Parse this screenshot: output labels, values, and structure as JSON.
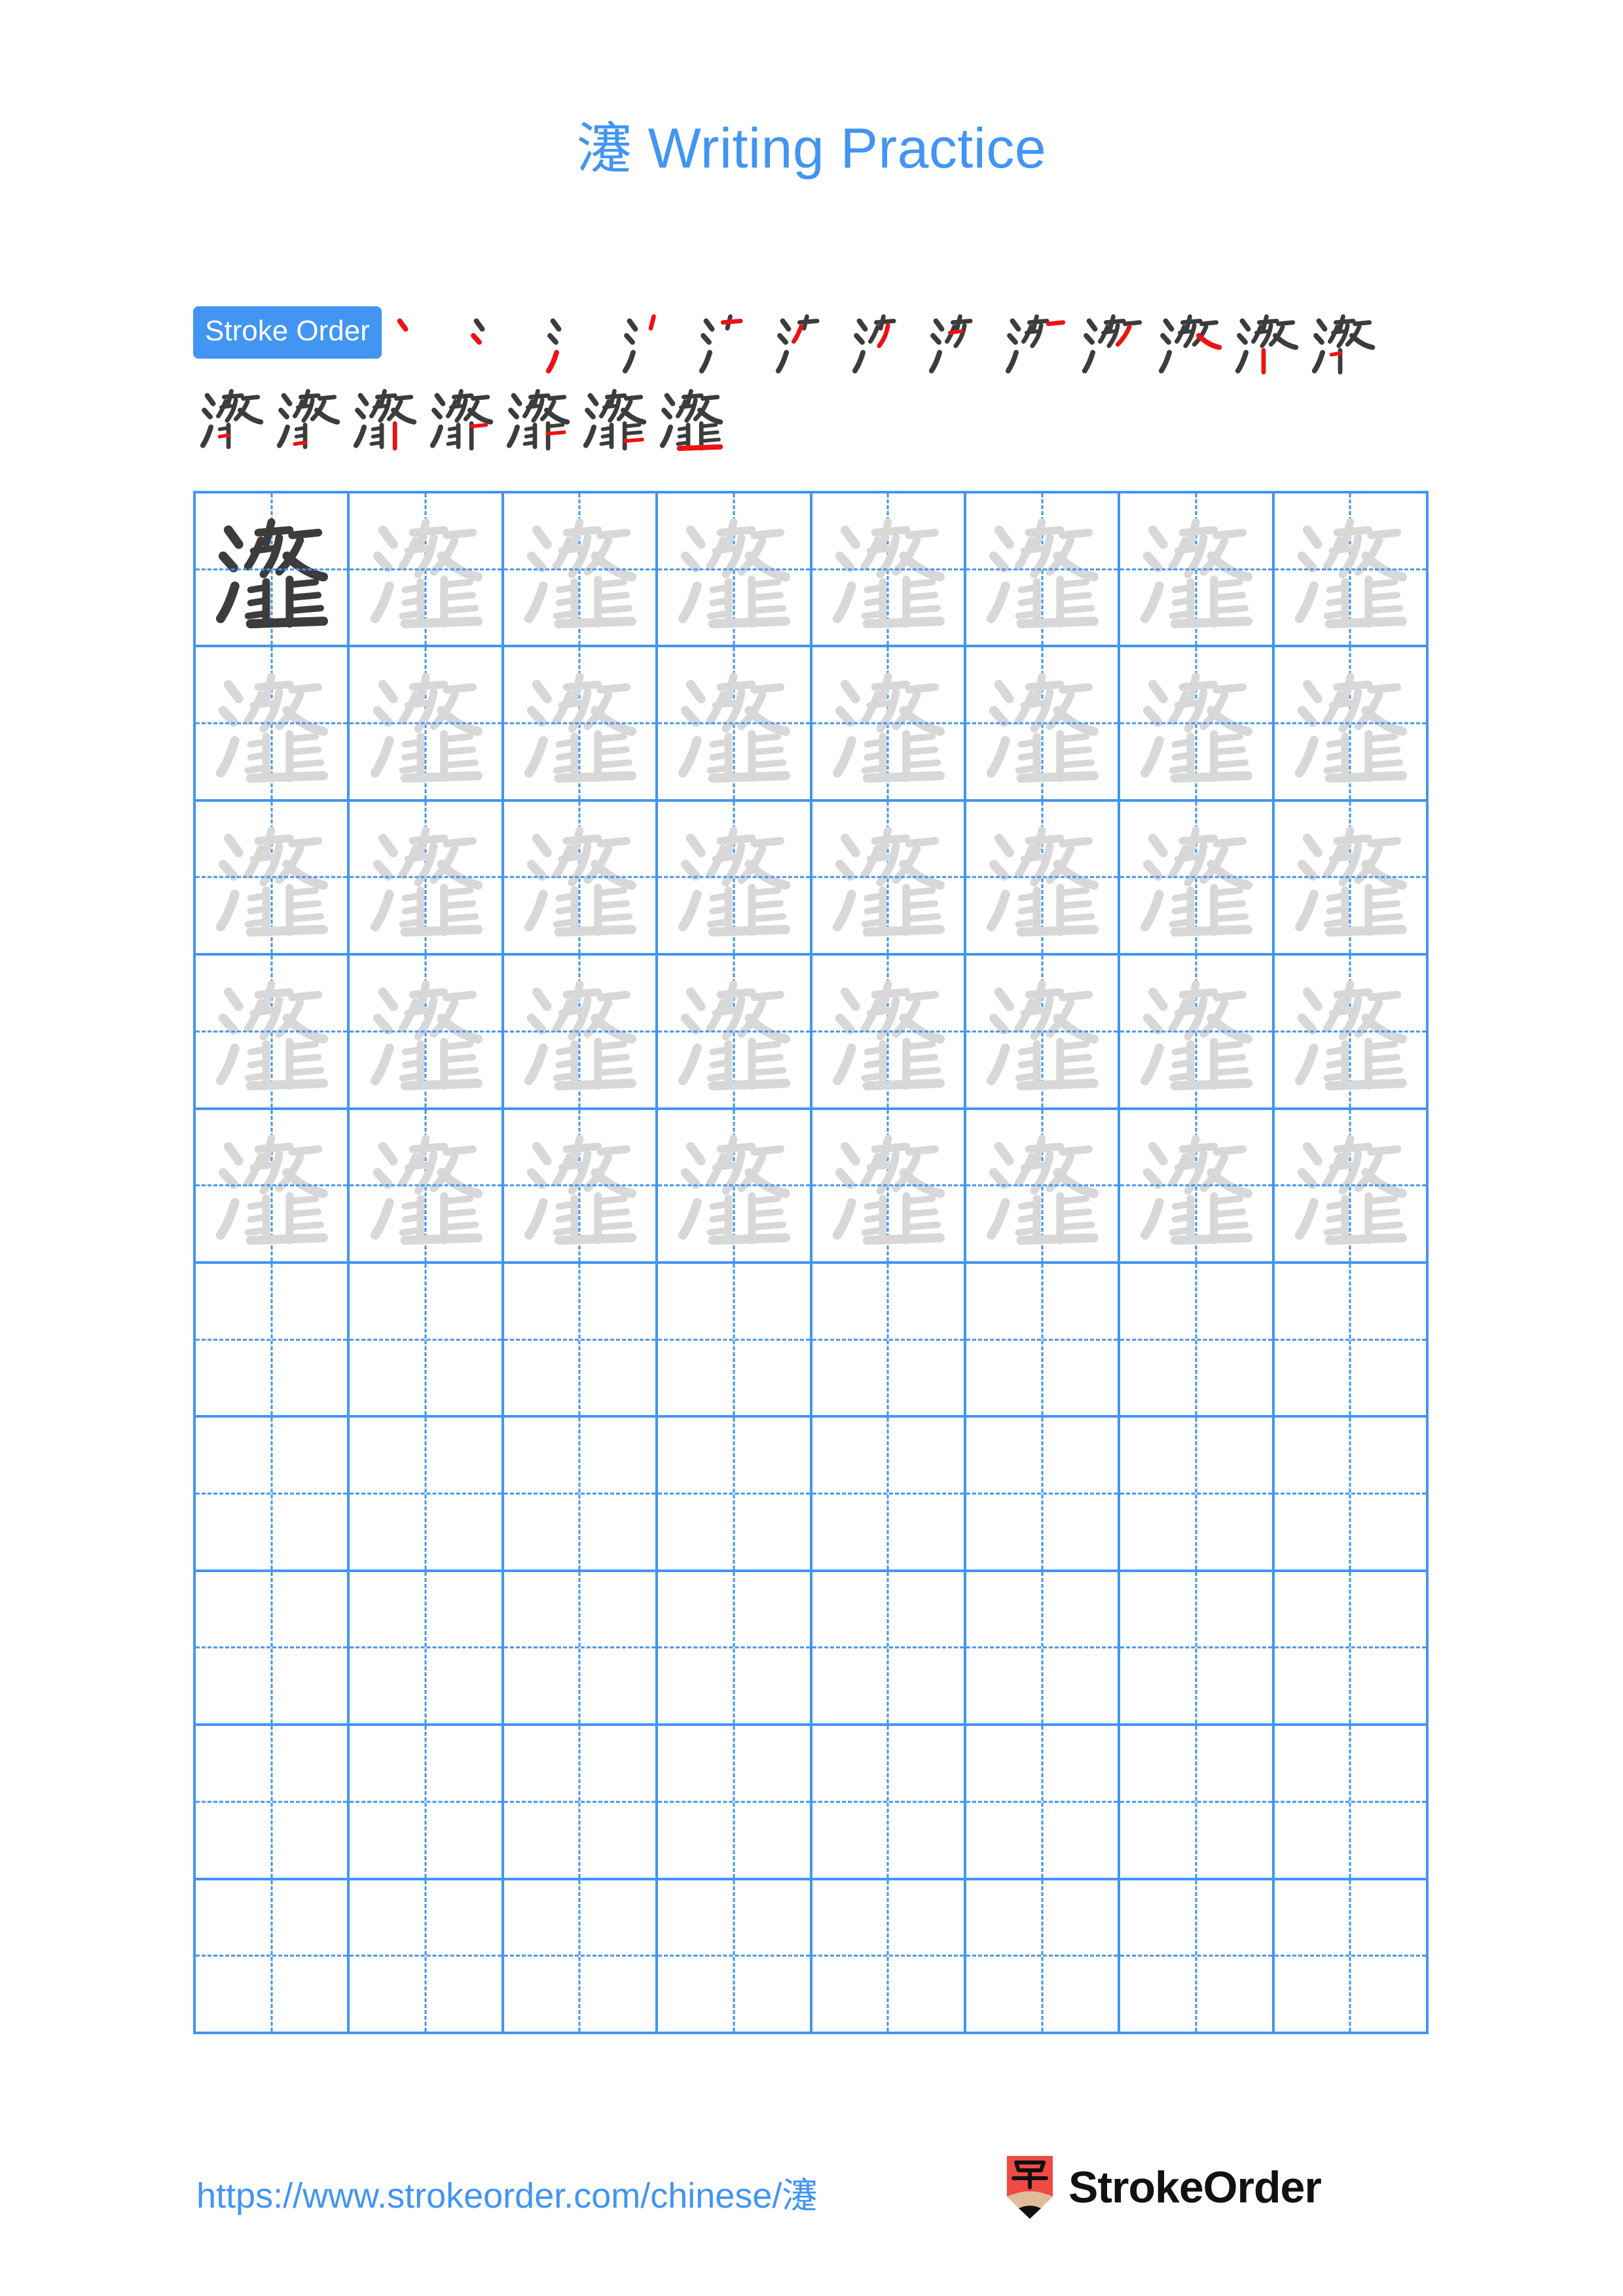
{
  "page": {
    "character": "瀽",
    "title_suffix": "Writing Practice",
    "background_color": "#ffffff",
    "accent_color": "#4295f2",
    "stroke_ink_color": "#3c3c3c",
    "new_stroke_color": "#ee1111",
    "guide_glyph_color": "#d8d8d8",
    "model_glyph_color": "#3c3c3c"
  },
  "stroke_order": {
    "badge_label": "Stroke Order",
    "total_strokes": 20,
    "steps": [
      {
        "index": 1,
        "row": 1
      },
      {
        "index": 2,
        "row": 1
      },
      {
        "index": 3,
        "row": 1
      },
      {
        "index": 4,
        "row": 1
      },
      {
        "index": 5,
        "row": 1
      },
      {
        "index": 6,
        "row": 1
      },
      {
        "index": 7,
        "row": 1
      },
      {
        "index": 8,
        "row": 1
      },
      {
        "index": 9,
        "row": 1
      },
      {
        "index": 10,
        "row": 1
      },
      {
        "index": 11,
        "row": 1
      },
      {
        "index": 12,
        "row": 1
      },
      {
        "index": 13,
        "row": 1
      },
      {
        "index": 14,
        "row": 2
      },
      {
        "index": 15,
        "row": 2
      },
      {
        "index": 16,
        "row": 2
      },
      {
        "index": 17,
        "row": 2
      },
      {
        "index": 18,
        "row": 2
      },
      {
        "index": 19,
        "row": 2
      },
      {
        "index": 20,
        "row": 2
      }
    ]
  },
  "practice_grid": {
    "columns": 8,
    "rows": 10,
    "filled_rows": 5,
    "empty_rows": 5,
    "model_cell_index": 0,
    "cell_character": "瀽"
  },
  "footer": {
    "url_prefix": "https://www.strokeorder.com/chinese/",
    "url_character": "瀽",
    "brand_name": "StrokeOrder",
    "brand_mark_character": "字",
    "brand_mark_color": "#ef4a44",
    "brand_mark_wood_color": "#e0bd98"
  }
}
